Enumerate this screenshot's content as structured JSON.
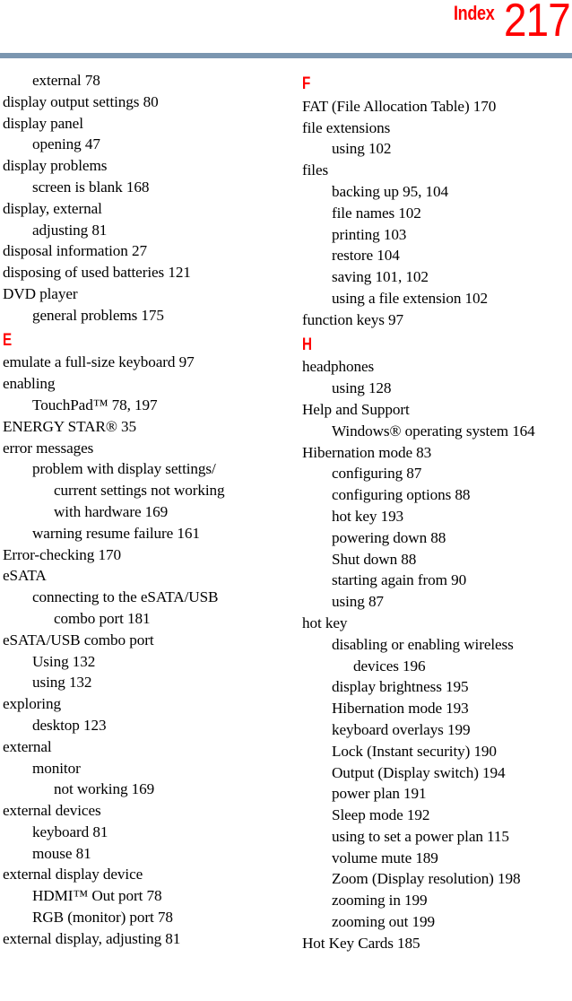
{
  "header": {
    "section_label": "Index",
    "page_number": "217",
    "accent_color": "#ff0000",
    "rule_color": "#7b96b0"
  },
  "columns": [
    {
      "name": "left",
      "entries": [
        {
          "level": 1,
          "text": "external 78"
        },
        {
          "level": 0,
          "text": "display output settings 80"
        },
        {
          "level": 0,
          "text": "display panel"
        },
        {
          "level": 1,
          "text": "opening 47"
        },
        {
          "level": 0,
          "text": "display problems"
        },
        {
          "level": 1,
          "text": "screen is blank 168"
        },
        {
          "level": 0,
          "text": "display, external"
        },
        {
          "level": 1,
          "text": "adjusting 81"
        },
        {
          "level": 0,
          "text": "disposal information 27"
        },
        {
          "level": 0,
          "text": "disposing of used batteries 121"
        },
        {
          "level": 0,
          "text": "DVD player"
        },
        {
          "level": 1,
          "text": "general problems 175"
        },
        {
          "letter": "E"
        },
        {
          "level": 0,
          "text": "emulate a full-size keyboard 97"
        },
        {
          "level": 0,
          "text": "enabling"
        },
        {
          "level": 1,
          "text": "TouchPad™ 78, 197"
        },
        {
          "level": 0,
          "text": "ENERGY STAR® 35"
        },
        {
          "level": 0,
          "text": "error messages"
        },
        {
          "level": 1,
          "text": "problem with display settings/"
        },
        {
          "level": 2,
          "text": "current settings not working"
        },
        {
          "level": 2,
          "text": "with hardware 169"
        },
        {
          "level": 1,
          "text": "warning resume failure 161"
        },
        {
          "level": 0,
          "text": "Error-checking 170"
        },
        {
          "level": 0,
          "text": "eSATA"
        },
        {
          "level": 1,
          "text": "connecting to the eSATA/USB"
        },
        {
          "level": 2,
          "text": "combo port 181"
        },
        {
          "level": 0,
          "text": "eSATA/USB combo port"
        },
        {
          "level": 1,
          "text": "Using 132"
        },
        {
          "level": 1,
          "text": "using 132"
        },
        {
          "level": 0,
          "text": "exploring"
        },
        {
          "level": 1,
          "text": "desktop 123"
        },
        {
          "level": 0,
          "text": "external"
        },
        {
          "level": 1,
          "text": "monitor"
        },
        {
          "level": 2,
          "text": "not working 169"
        },
        {
          "level": 0,
          "text": "external devices"
        },
        {
          "level": 1,
          "text": "keyboard 81"
        },
        {
          "level": 1,
          "text": "mouse 81"
        },
        {
          "level": 0,
          "text": "external display device"
        },
        {
          "level": 1,
          "text": "HDMI™ Out port 78"
        },
        {
          "level": 1,
          "text": "RGB (monitor) port 78"
        },
        {
          "level": 0,
          "text": "external display, adjusting 81"
        }
      ]
    },
    {
      "name": "right",
      "entries": [
        {
          "letter": "F"
        },
        {
          "level": 0,
          "text": "FAT (File Allocation Table) 170"
        },
        {
          "level": 0,
          "text": "file extensions"
        },
        {
          "level": 1,
          "text": "using 102"
        },
        {
          "level": 0,
          "text": "files"
        },
        {
          "level": 1,
          "text": "backing up 95, 104"
        },
        {
          "level": 1,
          "text": "file names 102"
        },
        {
          "level": 1,
          "text": "printing 103"
        },
        {
          "level": 1,
          "text": "restore 104"
        },
        {
          "level": 1,
          "text": "saving 101, 102"
        },
        {
          "level": 1,
          "text": "using a file extension 102"
        },
        {
          "level": 0,
          "text": "function keys 97"
        },
        {
          "letter": "H"
        },
        {
          "level": 0,
          "text": "headphones"
        },
        {
          "level": 1,
          "text": "using 128"
        },
        {
          "level": 0,
          "text": "Help and Support"
        },
        {
          "level": 1,
          "text": "Windows® operating system 164"
        },
        {
          "level": 0,
          "text": "Hibernation mode 83"
        },
        {
          "level": 1,
          "text": "configuring 87"
        },
        {
          "level": 1,
          "text": "configuring options 88"
        },
        {
          "level": 1,
          "text": "hot key 193"
        },
        {
          "level": 1,
          "text": "powering down 88"
        },
        {
          "level": 1,
          "text": "Shut down 88"
        },
        {
          "level": 1,
          "text": "starting again from 90"
        },
        {
          "level": 1,
          "text": "using 87"
        },
        {
          "level": 0,
          "text": "hot key"
        },
        {
          "level": 1,
          "text": "disabling or enabling wireless"
        },
        {
          "level": 2,
          "text": "devices 196"
        },
        {
          "level": 1,
          "text": "display brightness 195"
        },
        {
          "level": 1,
          "text": "Hibernation mode 193"
        },
        {
          "level": 1,
          "text": "keyboard overlays 199"
        },
        {
          "level": 1,
          "text": "Lock (Instant security) 190"
        },
        {
          "level": 1,
          "text": "Output (Display switch) 194"
        },
        {
          "level": 1,
          "text": "power plan 191"
        },
        {
          "level": 1,
          "text": "Sleep mode 192"
        },
        {
          "level": 1,
          "text": "using to set a power plan 115"
        },
        {
          "level": 1,
          "text": "volume mute 189"
        },
        {
          "level": 1,
          "text": "Zoom (Display resolution) 198"
        },
        {
          "level": 1,
          "text": "zooming in 199"
        },
        {
          "level": 1,
          "text": "zooming out 199"
        },
        {
          "level": 0,
          "text": "Hot Key Cards 185"
        }
      ]
    }
  ]
}
